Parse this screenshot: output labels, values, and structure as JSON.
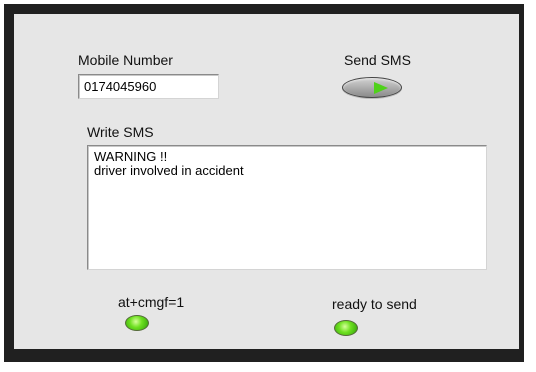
{
  "mobile": {
    "label": "Mobile Number",
    "value": "0174045960"
  },
  "send": {
    "label": "Send SMS"
  },
  "sms": {
    "label": "Write SMS",
    "lines": [
      "WARNING !!",
      "driver involved in accident"
    ]
  },
  "indicators": [
    {
      "label": "at+cmgf=1",
      "state": "on",
      "color": "#4fd11a"
    },
    {
      "label": "ready to send",
      "state": "on",
      "color": "#4fd11a"
    }
  ]
}
